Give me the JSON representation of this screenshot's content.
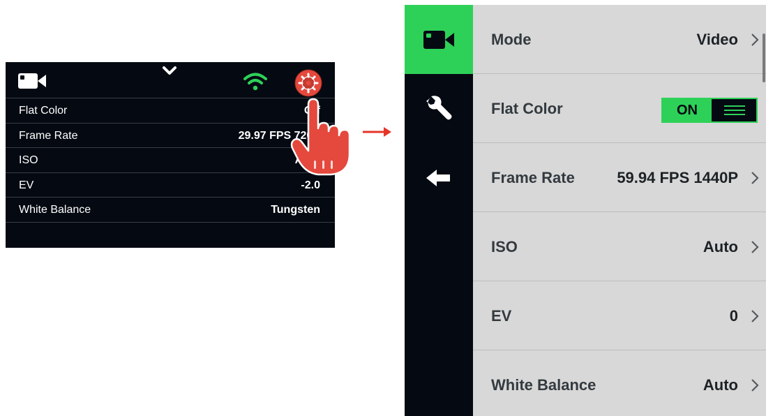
{
  "small_screen": {
    "rows": [
      {
        "label": "Flat Color",
        "value": "Off"
      },
      {
        "label": "Frame Rate",
        "value": "29.97 FPS 720P"
      },
      {
        "label": "ISO",
        "value": "Auto"
      },
      {
        "label": "EV",
        "value": "-2.0"
      },
      {
        "label": "White Balance",
        "value": "Tungsten"
      }
    ]
  },
  "big_screen": {
    "menu": [
      {
        "label": "Mode",
        "value": "Video"
      },
      {
        "label": "Flat Color",
        "toggle": "ON"
      },
      {
        "label": "Frame Rate",
        "value": "59.94 FPS 1440P"
      },
      {
        "label": "ISO",
        "value": "Auto"
      },
      {
        "label": "EV",
        "value": "0"
      },
      {
        "label": "White Balance",
        "value": "Auto"
      }
    ]
  },
  "colors": {
    "accent_green": "#2ed158",
    "screen_bg": "#050a12",
    "menu_bg": "#d8d8d8",
    "pointer_red": "#e5483c"
  },
  "icons": {
    "small_top": [
      "video-camera-icon",
      "chevron-down-icon",
      "wifi-icon",
      "gear-icon"
    ],
    "sidebar": [
      "video-camera-icon",
      "wrench-icon",
      "back-arrow-icon"
    ],
    "overlay": [
      "pointing-hand-icon",
      "right-arrow-icon"
    ]
  }
}
